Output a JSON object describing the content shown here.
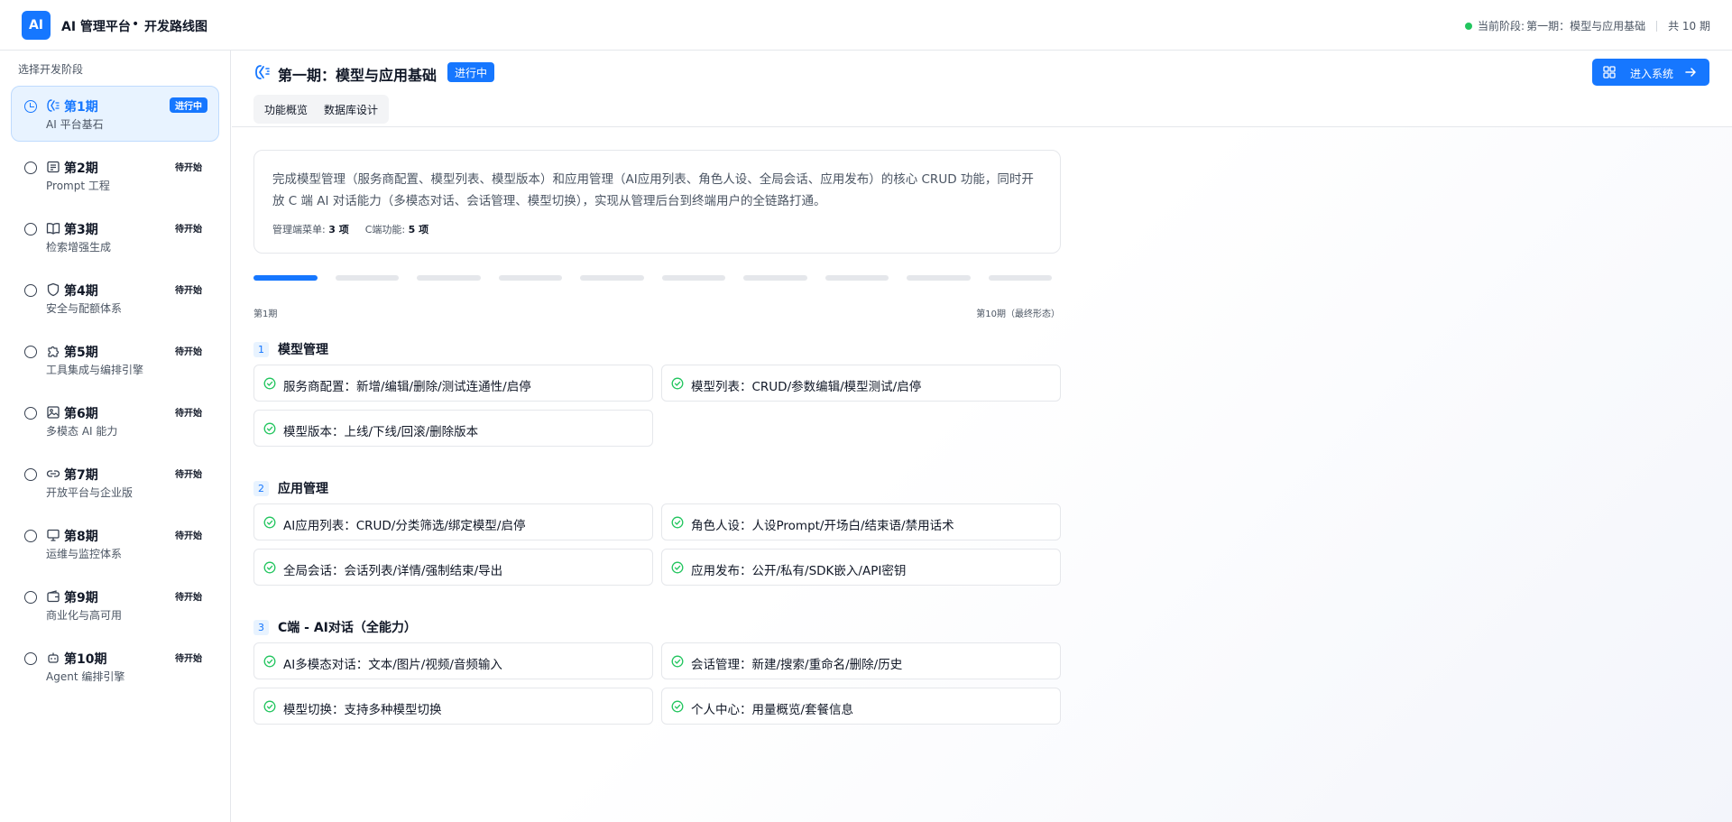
{
  "app": {
    "logo": "AI",
    "title": "AI 管理平台",
    "dot": "•",
    "subtitle": "开发路线图"
  },
  "status": {
    "label": "当前阶段:",
    "value": "第一期：模型与应用基础",
    "total": "共 10 期",
    "dot_color": "#22c55e"
  },
  "sidebar": {
    "header": "选择开发阶段",
    "items": [
      {
        "title": "第1期",
        "desc": "AI 平台基石",
        "badge": "进行中",
        "icon": "ai-icon"
      },
      {
        "title": "第2期",
        "desc": "Prompt 工程",
        "badge": "待开始",
        "icon": "document-icon"
      },
      {
        "title": "第3期",
        "desc": "检索增强生成",
        "badge": "待开始",
        "icon": "book-icon"
      },
      {
        "title": "第4期",
        "desc": "安全与配额体系",
        "badge": "待开始",
        "icon": "shield-icon"
      },
      {
        "title": "第5期",
        "desc": "工具集成与编排引擎",
        "badge": "待开始",
        "icon": "puzzle-icon"
      },
      {
        "title": "第6期",
        "desc": "多模态 AI 能力",
        "badge": "待开始",
        "icon": "image-icon"
      },
      {
        "title": "第7期",
        "desc": "开放平台与企业版",
        "badge": "待开始",
        "icon": "link-icon"
      },
      {
        "title": "第8期",
        "desc": "运维与监控体系",
        "badge": "待开始",
        "icon": "monitor-icon"
      },
      {
        "title": "第9期",
        "desc": "商业化与高可用",
        "badge": "待开始",
        "icon": "wallet-icon"
      },
      {
        "title": "第10期",
        "desc": "Agent 编排引擎",
        "badge": "待开始",
        "icon": "bot-icon"
      }
    ]
  },
  "main": {
    "title": "第一期：模型与应用基础",
    "badge": "进行中",
    "enter_button": "进入系统",
    "tabs": [
      "功能概览",
      "数据库设计"
    ],
    "description": "完成模型管理（服务商配置、模型列表、模型版本）和应用管理（AI应用列表、角色人设、全局会话、应用发布）的核心 CRUD 功能，同时开放 C 端 AI 对话能力（多模态对话、会话管理、模型切换），实现从管理后台到终端用户的全链路打通。",
    "stats": [
      {
        "label": "管理端菜单:",
        "value": "3 项"
      },
      {
        "label": "C端功能:",
        "value": "5 项"
      }
    ],
    "progress": {
      "current": 1,
      "total": 10,
      "left_label": "第1期",
      "right_label": "第10期（最终形态）"
    },
    "sections": [
      {
        "num": "1",
        "name": "模型管理",
        "features": [
          "服务商配置：新增/编辑/删除/测试连通性/启停",
          "模型列表：CRUD/参数编辑/模型测试/启停",
          "模型版本：上线/下线/回滚/删除版本"
        ]
      },
      {
        "num": "2",
        "name": "应用管理",
        "features": [
          "AI应用列表：CRUD/分类筛选/绑定模型/启停",
          "角色人设：人设Prompt/开场白/结束语/禁用话术",
          "全局会话：会话列表/详情/强制结束/导出",
          "应用发布：公开/私有/SDK嵌入/API密钥"
        ]
      },
      {
        "num": "3",
        "name": "C端 - AI对话（全能力）",
        "features": [
          "AI多模态对话：文本/图片/视频/音频输入",
          "会话管理：新建/搜索/重命名/删除/历史",
          "模型切换：支持多种模型切换",
          "个人中心：用量概览/套餐信息"
        ]
      }
    ]
  },
  "colors": {
    "accent": "#1677ff",
    "accent_light": "#e8f3ff",
    "success": "#22c55e"
  }
}
